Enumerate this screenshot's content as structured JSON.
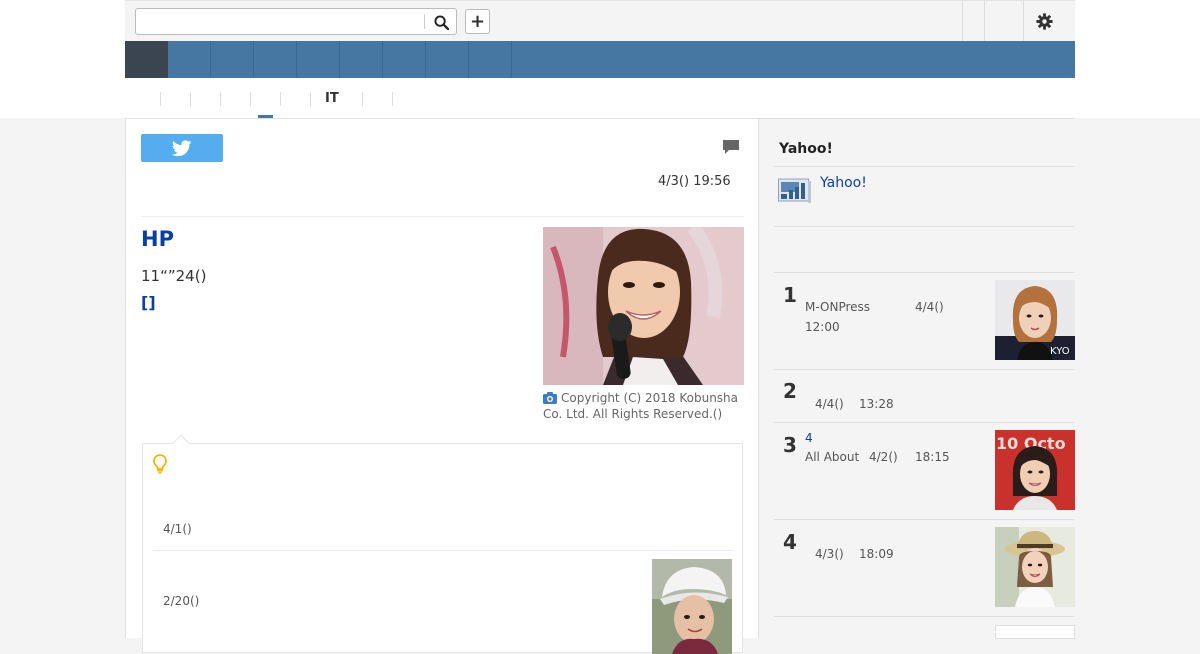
{
  "search": {
    "placeholder": ""
  },
  "article": {
    "date": "4/3() 19:56",
    "headline": "HP",
    "summary": "11“”24()",
    "more_link": "[]",
    "photo_caption": "Copyright (C) 2018 Kobunsha Co. Ltd. All Rights Reserved.()"
  },
  "subnav": {
    "it_label": "IT"
  },
  "related": {
    "item1_date": "4/1()",
    "item2_date": "2/20()"
  },
  "sidebar": {
    "title": "Yahoo!",
    "yahoo_link": "Yahoo!",
    "ranking": [
      {
        "rank": "1",
        "source": "M-ONPress",
        "date": "4/4()",
        "time": "12:00",
        "tag": ""
      },
      {
        "rank": "2",
        "source": "",
        "date": "4/4()",
        "time": "13:28",
        "tag": ""
      },
      {
        "rank": "3",
        "source": "All About",
        "date": "4/2()",
        "time": "18:15",
        "tag": "4"
      },
      {
        "rank": "4",
        "source": "",
        "date": "4/3()",
        "time": "18:09",
        "tag": ""
      }
    ]
  },
  "icons": {
    "search": "search-icon",
    "plus": "plus-icon",
    "settings": "gear-icon",
    "twitter": "twitter-bird-icon",
    "comment": "comment-icon",
    "camera": "camera-icon",
    "bulb": "lightbulb-icon",
    "yahoo": "yahoo-news-icon"
  },
  "colors": {
    "nav_blue": "#4677a3",
    "nav_home": "#3b4550",
    "link_blue": "#0a3fa6",
    "twitter_blue": "#55acee",
    "bulb_yellow": "#f0b400"
  }
}
